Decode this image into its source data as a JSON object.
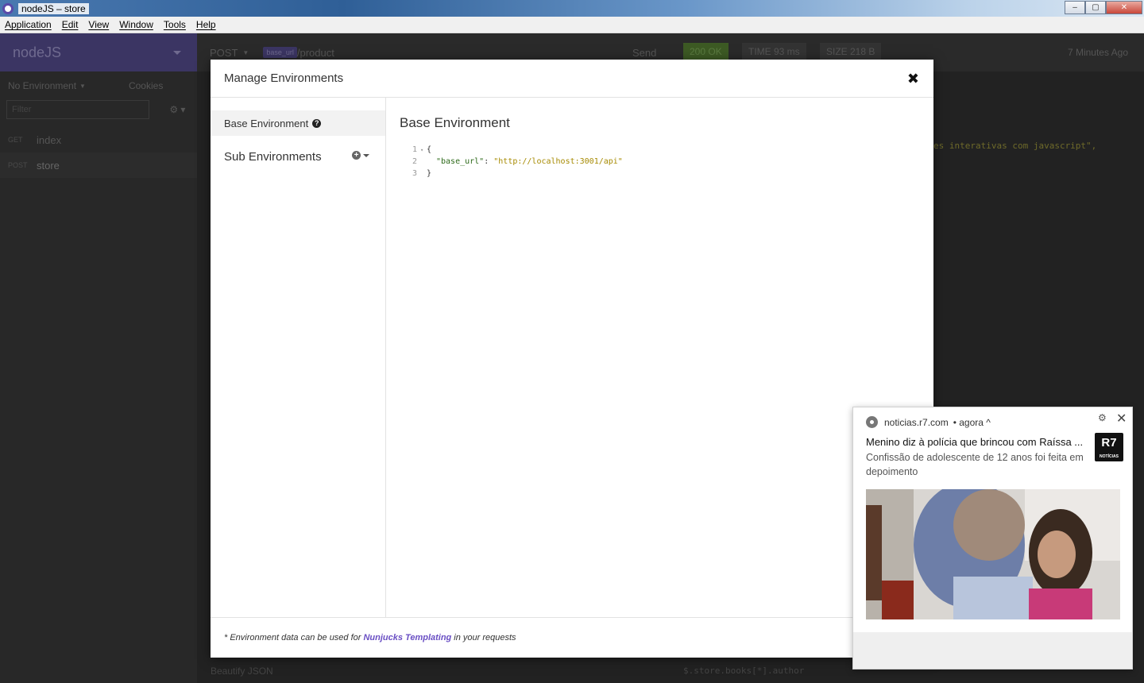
{
  "window": {
    "title": "nodeJS – store",
    "controls": {
      "minimize": "–",
      "maximize": "▢",
      "close": "✕"
    }
  },
  "menu": [
    "Application",
    "Edit",
    "View",
    "Window",
    "Tools",
    "Help"
  ],
  "sidebar": {
    "workspace": "nodeJS",
    "environment": "No Environment",
    "cookies": "Cookies",
    "filter_placeholder": "Filter",
    "requests": [
      {
        "method": "GET",
        "name": "index"
      },
      {
        "method": "POST",
        "name": "store"
      }
    ]
  },
  "request": {
    "method": "POST",
    "url_tag": "base_url",
    "url_path": "/product",
    "send": "Send",
    "status": "200 OK",
    "time": "TIME 93 ms",
    "size": "SIZE 218 B",
    "ago": "7 Minutes Ago",
    "response_snippet": "es interativas com javascript\",",
    "beautify": "Beautify JSON",
    "filter_expr": "$.store.books[*].author"
  },
  "modal": {
    "title": "Manage Environments",
    "close": "✖",
    "base_env_label": "Base Environment",
    "sub_env_label": "Sub Environments",
    "editor_title": "Base Environment",
    "code_lines": [
      {
        "n": "1",
        "text": "{"
      },
      {
        "n": "2",
        "key": "\"base_url\"",
        "sep": ": ",
        "value": "\"http://localhost:3001/api\""
      },
      {
        "n": "3",
        "text": "}"
      }
    ],
    "footer": {
      "prefix": "* Environment data can be used for",
      "link": "Nunjucks Templating",
      "suffix": "in your requests"
    }
  },
  "notification": {
    "source": "noticias.r7.com",
    "time": "• agora ^",
    "title": "Menino diz à polícia que brincou com Raíssa ...",
    "body": "Confissão de adolescente de 12 anos foi feita em depoimento",
    "logo_text": "R7",
    "logo_sub": "NOTÍCIAS"
  }
}
